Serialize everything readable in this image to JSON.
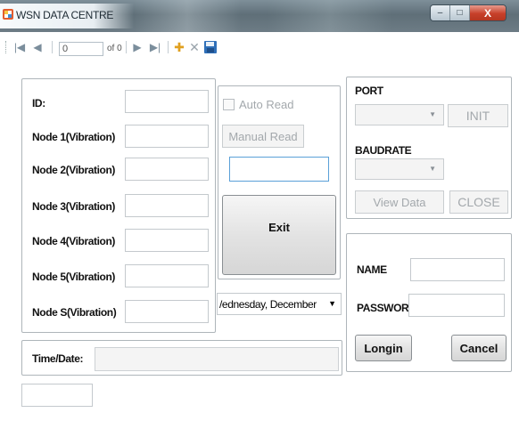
{
  "window": {
    "title": "WSN DATA CENTRE",
    "controls": {
      "minimize": "–",
      "maximize": "□",
      "close": "X"
    }
  },
  "toolbar": {
    "first": "|◀",
    "prev": "◀",
    "position": "0",
    "of_count": "of 0",
    "next": "▶",
    "last": "▶|",
    "add": "✚",
    "delete": "✕",
    "save_icon": "save-icon"
  },
  "nodes_panel": {
    "rows": [
      {
        "label": "ID:",
        "value": ""
      },
      {
        "label": "Node 1(Vibration)",
        "value": ""
      },
      {
        "label": "Node 2(Vibration)",
        "value": ""
      },
      {
        "label": "Node 3(Vibration)",
        "value": ""
      },
      {
        "label": "Node 4(Vibration)",
        "value": ""
      },
      {
        "label": "Node 5(Vibration)",
        "value": ""
      },
      {
        "label": "Node S(Vibration)",
        "value": ""
      }
    ]
  },
  "read_panel": {
    "auto_read_label": "Auto Read",
    "auto_read_checked": false,
    "manual_read_label": "Manual Read",
    "read_value": "",
    "exit_label": "Exit"
  },
  "date_picker": {
    "value": "/ednesday, December"
  },
  "time_panel": {
    "label": "Time/Date:",
    "value": ""
  },
  "status_box": {
    "value": ""
  },
  "port_panel": {
    "port_label": "PORT",
    "port_value": "",
    "init_label": "INIT",
    "baudrate_label": "BAUDRATE",
    "baudrate_value": "",
    "view_data_label": "View Data",
    "close_label": "CLOSE"
  },
  "login_panel": {
    "name_label": "NAME",
    "name_value": "",
    "password_label": "PASSWORD",
    "password_value": "",
    "login_label": "Longin",
    "cancel_label": "Cancel"
  },
  "colors": {
    "titlebar": "#6d7c85",
    "close_button": "#c7402a",
    "disabled_text": "#a3a8ac",
    "group_border": "#aeb5ba",
    "focus_border": "#5aa0d8"
  }
}
